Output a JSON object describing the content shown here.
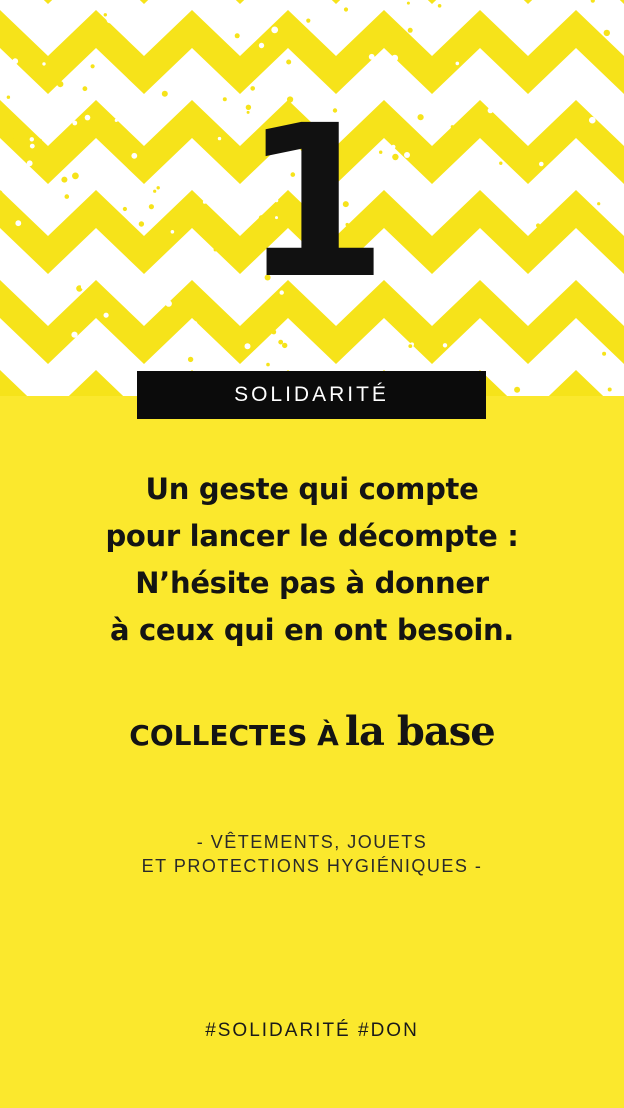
{
  "number": "1",
  "banner": "SOLIDARITÉ",
  "message": {
    "line1": "Un geste qui compte",
    "line2": "pour lancer le décompte :",
    "line3": "N’hésite pas à donner",
    "line4": "à ceux qui en ont besoin."
  },
  "collect": {
    "prefix": "COLLECTES À",
    "brand": "la base"
  },
  "items": {
    "line1": "- VÊTEMENTS, JOUETS",
    "line2": "ET PROTECTIONS HYGIÉNIQUES -"
  },
  "hashtags": "#SOLIDARITÉ #DON",
  "colors": {
    "yellow": "#fbe82d",
    "chevron_yellow": "#f6e31a",
    "white": "#ffffff",
    "black": "#0b0b0b"
  }
}
